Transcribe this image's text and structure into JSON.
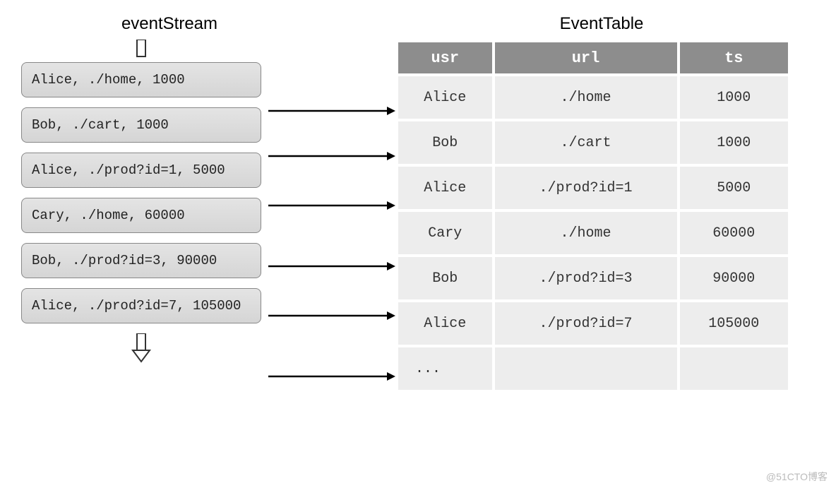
{
  "titles": {
    "stream": "eventStream",
    "table": "EventTable"
  },
  "stream_items": [
    {
      "text": "Alice,  ./home,  1000"
    },
    {
      "text": "Bob,  ./cart,  1000"
    },
    {
      "text": "Alice,  ./prod?id=1,  5000"
    },
    {
      "text": "Cary,  ./home,  60000"
    },
    {
      "text": "Bob,  ./prod?id=3,  90000"
    },
    {
      "text": "Alice,  ./prod?id=7,  105000"
    }
  ],
  "table": {
    "headers": {
      "usr": "usr",
      "url": "url",
      "ts": "ts"
    },
    "rows": [
      {
        "usr": "Alice",
        "url": "./home",
        "ts": "1000"
      },
      {
        "usr": "Bob",
        "url": "./cart",
        "ts": "1000"
      },
      {
        "usr": "Alice",
        "url": "./prod?id=1",
        "ts": "5000"
      },
      {
        "usr": "Cary",
        "url": "./home",
        "ts": "60000"
      },
      {
        "usr": "Bob",
        "url": "./prod?id=3",
        "ts": "90000"
      },
      {
        "usr": "Alice",
        "url": "./prod?id=7",
        "ts": "105000"
      },
      {
        "usr": "...",
        "url": "",
        "ts": ""
      }
    ]
  },
  "watermark": "@51CTO博客",
  "chart_data": {
    "type": "table",
    "title": "EventTable",
    "columns": [
      "usr",
      "url",
      "ts"
    ],
    "rows": [
      [
        "Alice",
        "./home",
        1000
      ],
      [
        "Bob",
        "./cart",
        1000
      ],
      [
        "Alice",
        "./prod?id=1",
        5000
      ],
      [
        "Cary",
        "./home",
        60000
      ],
      [
        "Bob",
        "./prod?id=3",
        90000
      ],
      [
        "Alice",
        "./prod?id=7",
        105000
      ]
    ],
    "note": "Diagram shows a stream of (usr, url, ts) events flowing into an EventTable"
  }
}
